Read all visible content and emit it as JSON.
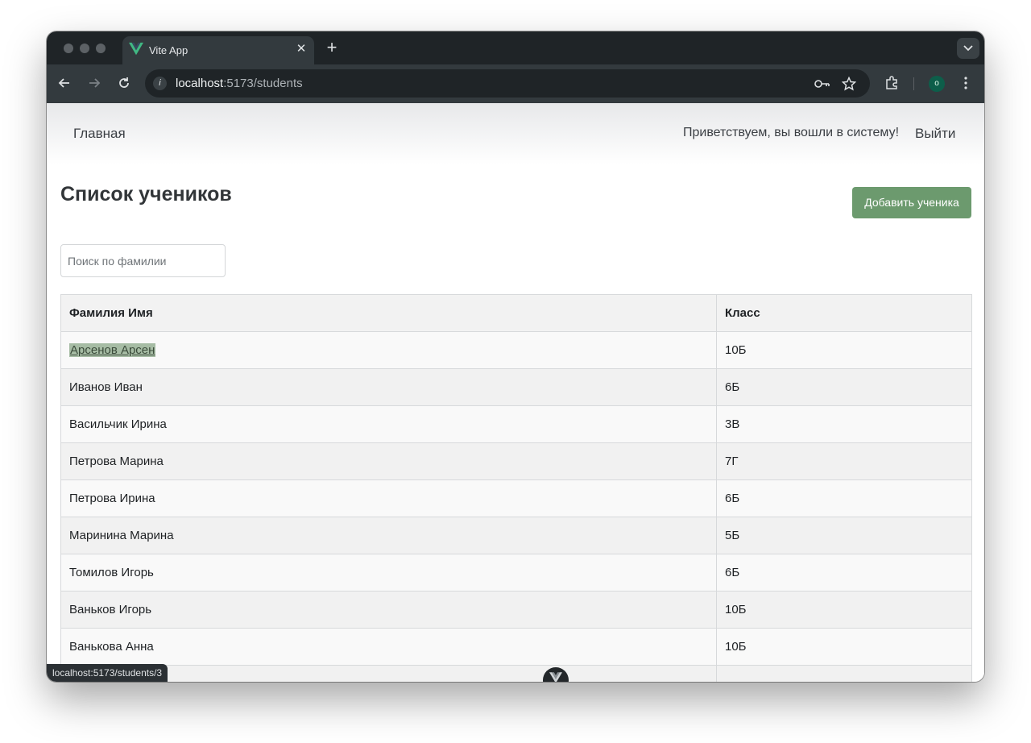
{
  "browser": {
    "tab_title": "Vite App",
    "url_host": "localhost",
    "url_rest": ":5173/students",
    "profile_initial": "o",
    "status_url": "localhost:5173/students/3"
  },
  "nav": {
    "home": "Главная",
    "greeting": "Приветствуем, вы вошли в систему!",
    "logout": "Выйти"
  },
  "main": {
    "title": "Список учеников",
    "add_button": "Добавить ученика",
    "search_placeholder": "Поиск по фамилии"
  },
  "table": {
    "headers": [
      "Фамилия Имя",
      "Класс"
    ],
    "rows": [
      {
        "name": "Арсенов Арсен",
        "class": "10Б"
      },
      {
        "name": "Иванов Иван",
        "class": "6Б"
      },
      {
        "name": "Васильчик Ирина",
        "class": "3В"
      },
      {
        "name": "Петрова Марина",
        "class": "7Г"
      },
      {
        "name": "Петрова Ирина",
        "class": "6Б"
      },
      {
        "name": "Маринина Марина",
        "class": "5Б"
      },
      {
        "name": "Томилов Игорь",
        "class": "6Б"
      },
      {
        "name": "Ваньков Игорь",
        "class": "10Б"
      },
      {
        "name": "Ванькова Анна",
        "class": "10Б"
      }
    ]
  },
  "colors": {
    "accent_button": "#6c9a6e",
    "link_highlight": "#a6bca4",
    "vue_green": "#41b883"
  }
}
